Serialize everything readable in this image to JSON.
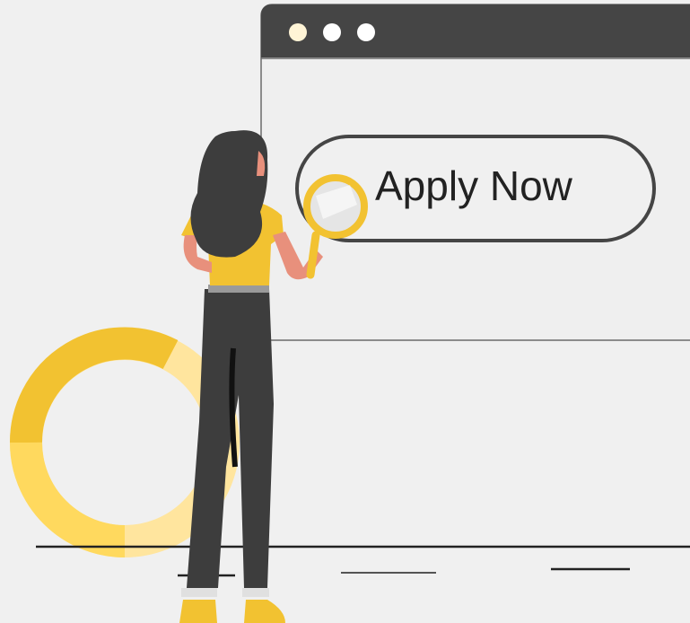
{
  "button": {
    "label": "Apply Now"
  },
  "window": {
    "controls": [
      "window-dot-1",
      "window-dot-2",
      "window-dot-3"
    ],
    "titlebar_color": "#454545",
    "body_color": "#efefef"
  },
  "colors": {
    "accent_yellow": "#f2c231",
    "light_yellow": "#ffd95e",
    "pale_yellow": "#ffe59e",
    "dark_gray": "#3f3f3f",
    "skin": "#e8907c"
  },
  "donut": {
    "segments": [
      0.22,
      0.28,
      0.22,
      0.28
    ]
  }
}
